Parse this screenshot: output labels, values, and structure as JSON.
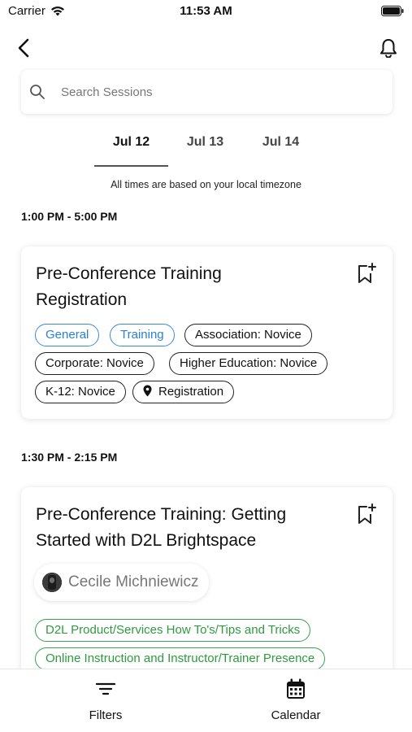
{
  "status_bar": {
    "carrier": "Carrier",
    "time": "11:53 AM"
  },
  "search": {
    "placeholder": "Search Sessions",
    "value": ""
  },
  "date_tabs": [
    {
      "label": "Jul 12",
      "active": true
    },
    {
      "label": "Jul 13",
      "active": false
    },
    {
      "label": "Jul 14",
      "active": false
    }
  ],
  "timezone_note": "All times are based on your local timezone",
  "sessions": [
    {
      "time": "1:00 PM - 5:00 PM",
      "title_line1": "Pre-Conference Training",
      "title_line2": "Registration",
      "tags": [
        "General",
        "Training",
        "Association: Novice",
        "Corporate: Novice",
        "Higher Education: Novice",
        "K-12: Novice"
      ],
      "location": "Registration"
    },
    {
      "time": "1:30 PM - 2:15 PM",
      "title_line1": "Pre-Conference Training: Getting",
      "title_line2": "Started with D2L Brightspace",
      "speaker": "Cecile Michniewicz",
      "tags": [
        "D2L Product/Services How To's/Tips and Tricks",
        "Online Instruction and Instructor/Trainer Presence"
      ]
    }
  ],
  "bottom_tabs": {
    "filters": "Filters",
    "calendar": "Calendar"
  },
  "colors": {
    "tag_blue": "#2b7fd4",
    "tag_green": "#2e9a3e"
  },
  "icons": [
    "wifi-icon",
    "battery-icon",
    "back-arrow-icon",
    "bell-icon",
    "search-icon",
    "bookmark-add-icon",
    "location-pin-icon",
    "filter-icon",
    "calendar-icon"
  ]
}
